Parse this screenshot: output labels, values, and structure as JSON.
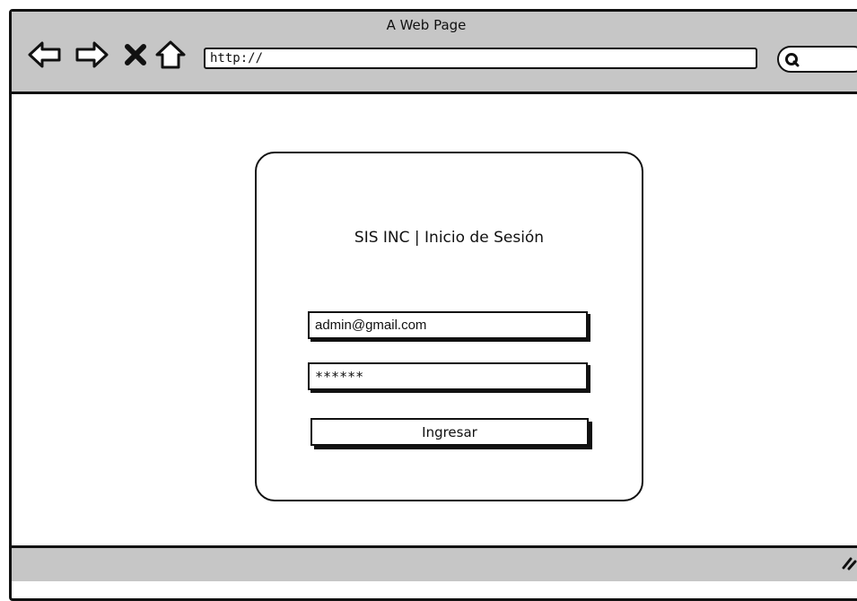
{
  "browser": {
    "title": "A Web Page",
    "url": "http://",
    "icons": {
      "back": "back-arrow-icon",
      "forward": "forward-arrow-icon",
      "stop": "close-icon",
      "home": "home-icon",
      "search": "search-icon",
      "resize": "resize-grip-icon"
    }
  },
  "login": {
    "title": "SIS INC | Inicio de Sesión",
    "email_value": "admin@gmail.com",
    "password_value": "******",
    "submit_label": "Ingresar"
  },
  "colors": {
    "chrome_gray": "#c6c6c6",
    "ink": "#111111",
    "background": "#ffffff"
  }
}
